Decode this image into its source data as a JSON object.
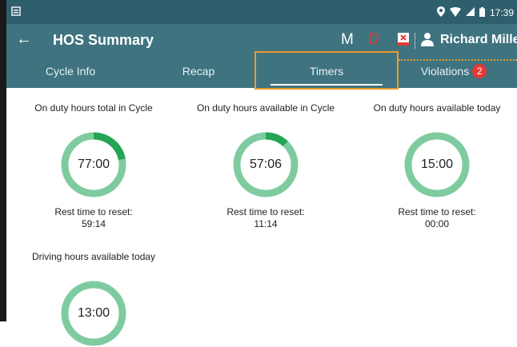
{
  "status_bar": {
    "time": "17:39"
  },
  "header": {
    "title": "HOS Summary",
    "mode_m": "M",
    "mode_d": "D",
    "user_name": "Richard  Miller"
  },
  "tabs": [
    {
      "label": "Cycle Info"
    },
    {
      "label": "Recap"
    },
    {
      "label": "Timers",
      "active": true
    },
    {
      "label": "Violations",
      "badge": "2"
    }
  ],
  "timers": [
    {
      "label": "On duty hours total in Cycle",
      "value": "77:00",
      "rest_label": "Rest time to reset:",
      "rest_value": "59:14",
      "used_fraction": 0.22
    },
    {
      "label": "On duty hours available in Cycle",
      "value": "57:06",
      "rest_label": "Rest time to reset:",
      "rest_value": "11:14",
      "used_fraction": 0.12
    },
    {
      "label": "On duty hours available today",
      "value": "15:00",
      "rest_label": "Rest time to reset:",
      "rest_value": "00:00",
      "used_fraction": 0
    },
    {
      "label": "Driving hours available today",
      "value": "13:00",
      "rest_label": "",
      "rest_value": "",
      "used_fraction": 0
    }
  ],
  "colors": {
    "status_bar": "#2f5f6c",
    "app_bar": "#3f7380",
    "ring_base": "#7fcba0",
    "ring_used": "#23a552",
    "highlight": "#ec9a2b",
    "badge": "#e53935"
  }
}
